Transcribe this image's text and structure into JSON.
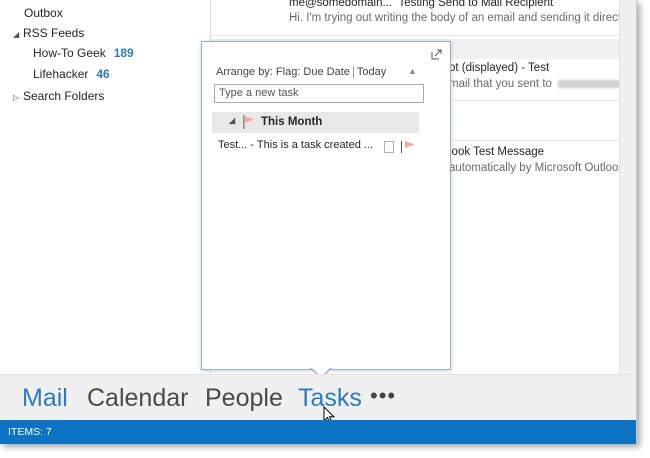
{
  "folders": {
    "items": [
      {
        "label": "Outbox",
        "count": ""
      },
      {
        "label": "RSS Feeds",
        "count": "",
        "expanded": true
      },
      {
        "label": "How-To Geek",
        "count": "189"
      },
      {
        "label": "Lifehacker",
        "count": "46"
      },
      {
        "label": "Search Folders",
        "count": "",
        "expanded": false
      }
    ]
  },
  "messages": [
    {
      "from": "me@somedomain...",
      "subject": "Testing Send to Mail Recipient",
      "preview": "Hi. I'm trying out writing the body of an email and sending it directly"
    },
    {
      "subject": "ot (displayed) - Test",
      "preview": "mail that you sent to"
    },
    {
      "subject": "look Test Message",
      "preview": "automatically by Microsoft Outlook w"
    }
  ],
  "tasks_peek": {
    "arrange_label": "Arrange by: Flag: Due Date",
    "sort_label": "Today",
    "new_task_placeholder": "Type a new task",
    "group_label": "This Month",
    "task_text": "Test... - This is a task created ..."
  },
  "nav": {
    "mail": "Mail",
    "calendar": "Calendar",
    "people": "People",
    "tasks": "Tasks",
    "more": "•••"
  },
  "status": {
    "items": "ITEMS: 7"
  },
  "colors": {
    "accent": "#2a7bc0",
    "status_bar": "#0c72c4"
  }
}
